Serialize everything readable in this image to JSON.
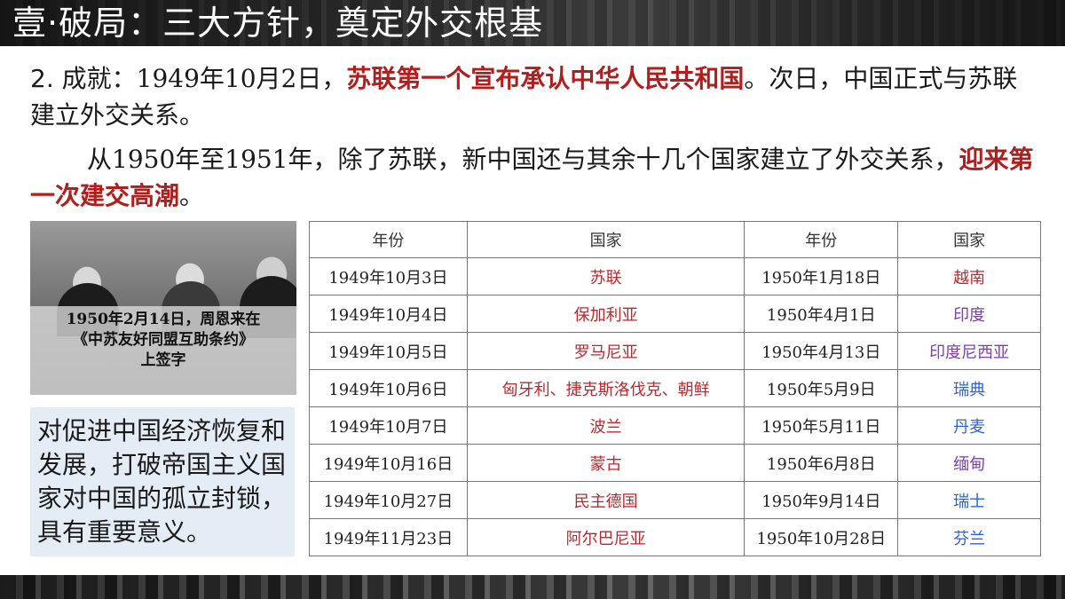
{
  "slide": {
    "title": "壹·破局：三大方针，奠定外交根基"
  },
  "paragraph1": {
    "lead": "2. 成就：",
    "text1": "1949年10月2日，",
    "highlight": "苏联第一个宣布承认中华人民共和国",
    "text2": "。次日，中国正式与苏联建立外交关系。"
  },
  "paragraph2": {
    "text1": "从1950年至1951年，除了苏联，新中国还与其余十几个国家建立了外交关系，",
    "highlight": "迎来第一次建交高潮",
    "text2": "。"
  },
  "photo": {
    "caption_line1": "1950年2月14日，周恩来在",
    "caption_line2": "《中苏友好同盟互助条约》",
    "caption_line3": "上签字"
  },
  "note": {
    "text": "对促进中国经济恢复和发展，打破帝国主义国家对中国的孤立封锁，具有重要意义。"
  },
  "table": {
    "headers": [
      "年份",
      "国家",
      "年份",
      "国家"
    ],
    "rows": [
      {
        "date1": "1949年10月3日",
        "country1": "苏联",
        "date2": "1950年1月18日",
        "country2": "越南",
        "color2": "red"
      },
      {
        "date1": "1949年10月4日",
        "country1": "保加利亚",
        "date2": "1950年4月1日",
        "country2": "印度",
        "color2": "purple"
      },
      {
        "date1": "1949年10月5日",
        "country1": "罗马尼亚",
        "date2": "1950年4月13日",
        "country2": "印度尼西亚",
        "color2": "purple"
      },
      {
        "date1": "1949年10月6日",
        "country1": "匈牙利、捷克斯洛伐克、朝鲜",
        "date2": "1950年5月9日",
        "country2": "瑞典",
        "color2": "blue"
      },
      {
        "date1": "1949年10月7日",
        "country1": "波兰",
        "date2": "1950年5月11日",
        "country2": "丹麦",
        "color2": "blue"
      },
      {
        "date1": "1949年10月16日",
        "country1": "蒙古",
        "date2": "1950年6月8日",
        "country2": "缅甸",
        "color2": "purple"
      },
      {
        "date1": "1949年10月27日",
        "country1": "民主德国",
        "date2": "1950年9月14日",
        "country2": "瑞士",
        "color2": "blue"
      },
      {
        "date1": "1949年11月23日",
        "country1": "阿尔巴尼亚",
        "date2": "1950年10月28日",
        "country2": "芬兰",
        "color2": "blue"
      }
    ]
  }
}
